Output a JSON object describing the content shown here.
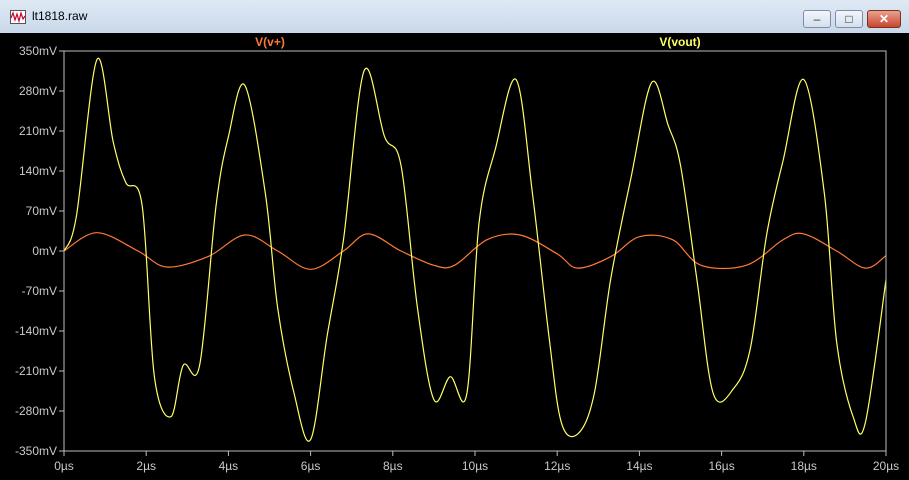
{
  "window": {
    "title": "lt1818.raw"
  },
  "chart_data": {
    "type": "line",
    "title": "",
    "xlabel": "",
    "ylabel": "",
    "xlim": [
      0,
      20
    ],
    "ylim": [
      -350,
      350
    ],
    "x_unit": "µs",
    "y_unit": "mV",
    "x_ticks": [
      "0µs",
      "2µs",
      "4µs",
      "6µs",
      "8µs",
      "10µs",
      "12µs",
      "14µs",
      "16µs",
      "18µs",
      "20µs"
    ],
    "y_ticks": [
      "350mV",
      "280mV",
      "210mV",
      "140mV",
      "70mV",
      "0mV",
      "-70mV",
      "-140mV",
      "-210mV",
      "-280mV",
      "-350mV"
    ],
    "grid": false,
    "legend_position": "top",
    "series": [
      {
        "name": "V(v+)",
        "color": "#ff7a33",
        "x": [
          0,
          0.8,
          1.8,
          2.5,
          3.5,
          4.4,
          5.2,
          6.0,
          6.8,
          7.4,
          8.2,
          9.0,
          9.5,
          10.3,
          11.1,
          12.0,
          12.5,
          13.3,
          14.0,
          14.8,
          15.5,
          16.6,
          17.5,
          18.0,
          18.8,
          19.5,
          20.0
        ],
        "values": [
          0,
          32,
          0,
          -28,
          -10,
          28,
          0,
          -32,
          0,
          30,
          0,
          -25,
          -25,
          20,
          28,
          -5,
          -30,
          -10,
          25,
          20,
          -25,
          -25,
          20,
          30,
          0,
          -30,
          -8
        ]
      },
      {
        "name": "V(vout)",
        "color": "#ffff66",
        "x": [
          0,
          0.3,
          0.8,
          1.2,
          1.5,
          1.9,
          2.2,
          2.6,
          2.9,
          3.3,
          3.7,
          4.0,
          4.4,
          4.9,
          5.2,
          5.6,
          6.0,
          6.4,
          6.8,
          7.3,
          7.8,
          8.2,
          8.6,
          9.0,
          9.4,
          9.8,
          10.1,
          10.5,
          11.0,
          11.4,
          11.8,
          12.1,
          12.5,
          12.9,
          13.3,
          13.8,
          14.3,
          14.7,
          15.0,
          15.4,
          15.8,
          16.3,
          16.7,
          17.1,
          17.5,
          18.0,
          18.5,
          18.8,
          19.2,
          19.5,
          20.0
        ],
        "values": [
          0,
          60,
          335,
          190,
          120,
          80,
          -220,
          -290,
          -200,
          -200,
          80,
          200,
          290,
          100,
          -100,
          -250,
          -330,
          -150,
          20,
          315,
          200,
          150,
          -100,
          -260,
          -220,
          -250,
          50,
          180,
          300,
          100,
          -150,
          -300,
          -320,
          -250,
          -50,
          130,
          295,
          220,
          150,
          -50,
          -250,
          -240,
          -170,
          30,
          160,
          300,
          100,
          -160,
          -290,
          -300,
          -50
        ]
      }
    ]
  }
}
